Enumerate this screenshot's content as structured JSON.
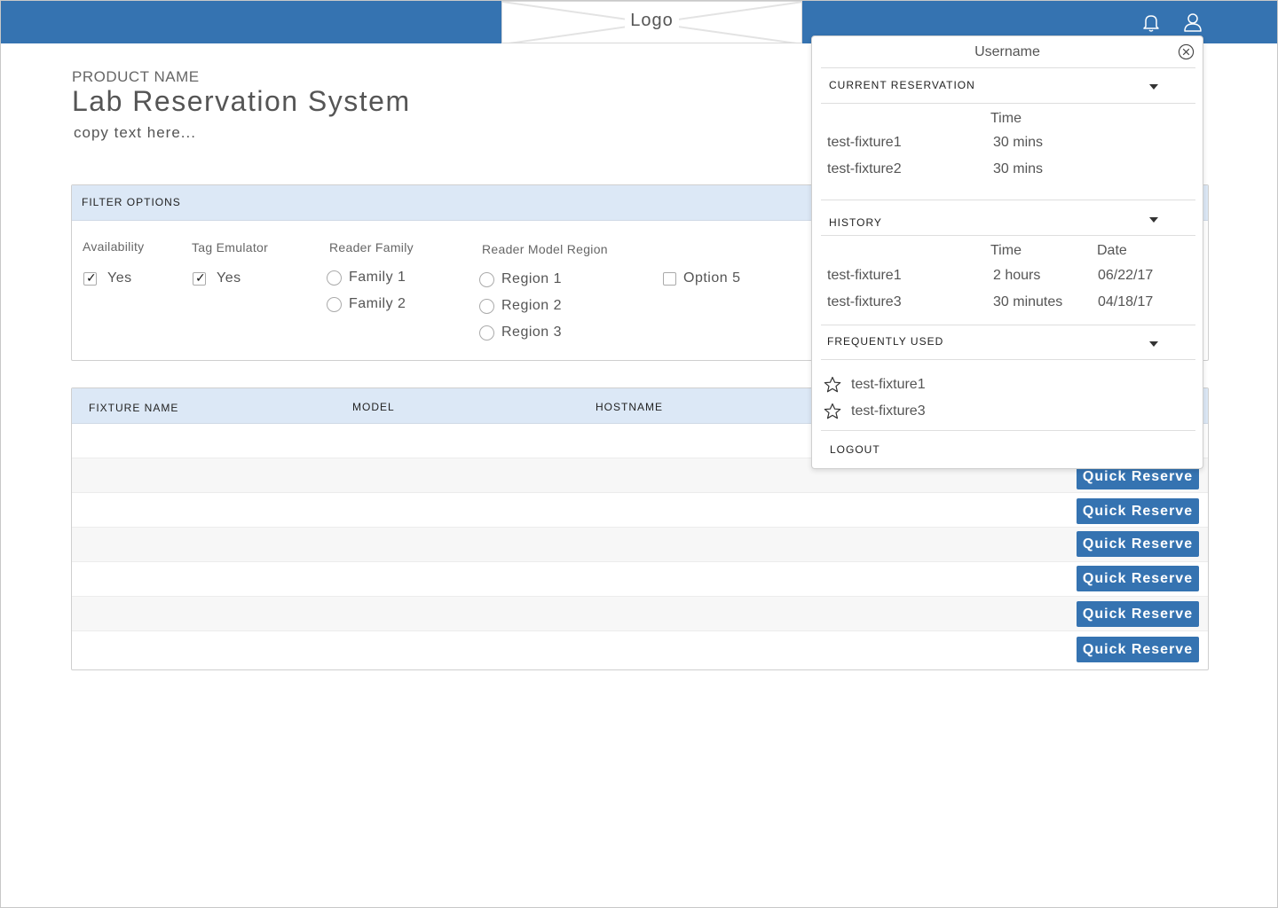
{
  "header": {
    "logo_text": "Logo",
    "icons": [
      "bell-icon",
      "user-icon"
    ]
  },
  "hero": {
    "product_name": "PRODUCT NAME",
    "title": "Lab Reservation System",
    "copy": "copy text here..."
  },
  "filters": {
    "title": "FILTER OPTIONS",
    "availability": {
      "label": "Availability",
      "option": "Yes",
      "checked": true
    },
    "tag_emulator": {
      "label": "Tag Emulator",
      "option": "Yes",
      "checked": true
    },
    "reader_family": {
      "label": "Reader Family",
      "options": [
        "Family 1",
        "Family 2"
      ]
    },
    "reader_model_region": {
      "label": "Reader Model Region",
      "options": [
        "Region 1",
        "Region 2",
        "Region 3"
      ]
    },
    "option5": {
      "label": "Option 5",
      "checked": false
    }
  },
  "table": {
    "columns": [
      "FIXTURE NAME",
      "MODEL",
      "HOSTNAME"
    ],
    "action_label": "Quick Reserve"
  },
  "user_panel": {
    "username": "Username",
    "current_reservation": {
      "title": "CURRENT RESERVATION",
      "time_header": "Time",
      "rows": [
        {
          "name": "test-fixture1",
          "time": "30 mins"
        },
        {
          "name": "test-fixture2",
          "time": "30 mins"
        }
      ]
    },
    "history": {
      "title": "HISTORY",
      "time_header": "Time",
      "date_header": "Date",
      "rows": [
        {
          "name": "test-fixture1",
          "time": "2 hours",
          "date": "06/22/17"
        },
        {
          "name": "test-fixture3",
          "time": "30 minutes",
          "date": "04/18/17"
        }
      ]
    },
    "frequently_used": {
      "title": "FREQUENTLY USED",
      "items": [
        "test-fixture1",
        "test-fixture3"
      ]
    },
    "logout_label": "LOGOUT"
  },
  "colors": {
    "brand": "#3573b1",
    "header_bg": "#dce8f6"
  }
}
